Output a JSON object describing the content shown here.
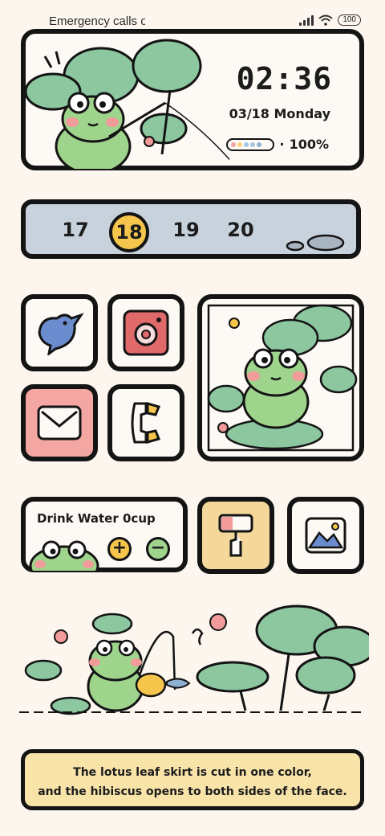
{
  "status": {
    "carrier_text": "Emergency calls o",
    "battery_level": "100"
  },
  "clock_widget": {
    "time": "02:36",
    "date": "03/18 Monday",
    "battery_percent": "100%",
    "battery_dot_colors": [
      "#f2a7a0",
      "#f6d27a",
      "#9ec9e8",
      "#a9c4dd",
      "#8fb0d3"
    ]
  },
  "calendar": {
    "days": [
      "17",
      "18",
      "19",
      "20"
    ],
    "today": "18",
    "today_color": "#f6c64c"
  },
  "apps": [
    {
      "icon": "bird-icon",
      "label": "Twitter"
    },
    {
      "icon": "camera-icon",
      "label": "Instagram"
    },
    {
      "icon": "mail-icon",
      "label": "Mail"
    },
    {
      "icon": "phone-icon",
      "label": "Phone"
    },
    {
      "icon": "paint-roller-icon",
      "label": "Theme"
    },
    {
      "icon": "gallery-icon",
      "label": "Gallery"
    }
  ],
  "water_widget": {
    "title": "Drink Water",
    "count": "0",
    "unit": "cup",
    "plus": "+",
    "minus": "−"
  },
  "caption": {
    "line1": "The lotus leaf skirt is cut in one color,",
    "line2": "and the hibiscus opens to both sides of the face."
  },
  "colors": {
    "leaf": "#8cc7a0",
    "frog": "#9fd48c",
    "blush": "#f29b9b",
    "strip": "#c7d2dc",
    "caption_bg": "#f8e3a9"
  }
}
